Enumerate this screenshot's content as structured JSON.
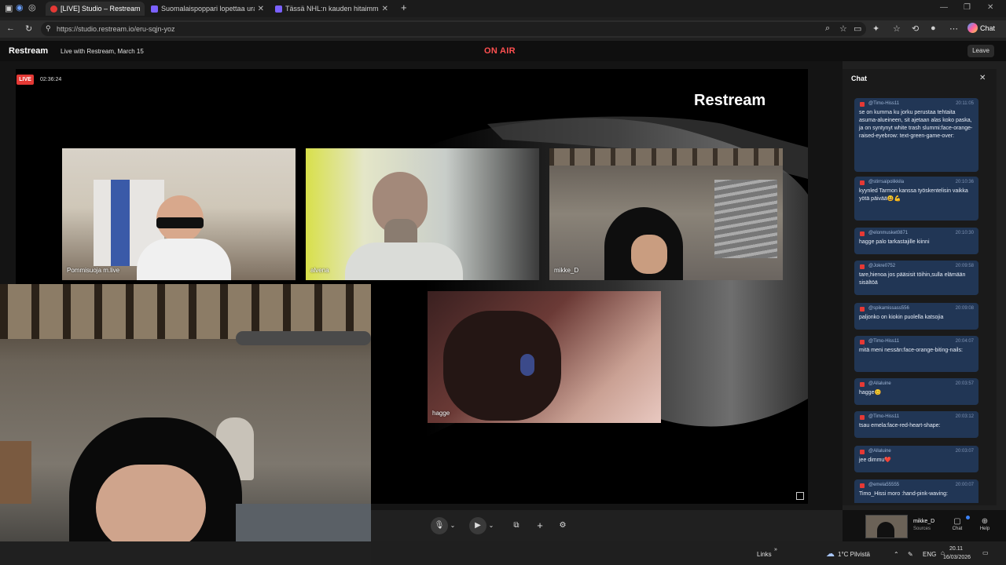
{
  "browser": {
    "tabs": [
      {
        "title": "[LIVE] Studio – Restream",
        "color": "#e53935",
        "active": true
      },
      {
        "title": "Suomalaispoppari lopettaa uransa",
        "color": "#7b61ff",
        "active": false
      },
      {
        "title": "Tässä NHL:n kauden hitaimmat pe",
        "color": "#7b61ff",
        "active": false
      }
    ],
    "new_tab": "+",
    "url": "https://studio.restream.io/eru-sqjn-yoz",
    "chat_button": "Chat"
  },
  "app": {
    "brand": "Restream",
    "stream_title": "Live with Restream, March 15",
    "on_air": "ON AIR",
    "leave": "Leave"
  },
  "stage": {
    "live_badge": "LIVE",
    "timer": "02:36:24",
    "logo": "Restream",
    "participants": [
      "Pommisuoja m.live",
      "alvena",
      "mikke_D",
      "hagge"
    ]
  },
  "chat": {
    "title": "Chat",
    "messages": [
      {
        "user": "@Timo-Hiss11",
        "time": "20:11:05",
        "text": "se on kumma ku jorku perustaa tehtaita asuma-alueineen, sit ajetaan alas koko paska, ja on syntynyt white trash slummi:face-orange-raised-eyebrow: text-green-game-over:"
      },
      {
        "user": "@stirrsaipolikkila",
        "time": "20:10:36",
        "text": "kyynled Tarmon kanssa työskentelisin vaikka yötä päivää😃💪"
      },
      {
        "user": "@elonmusket0871",
        "time": "20:10:30",
        "text": "hagge palo tarkastajille kiinni"
      },
      {
        "user": "@Jokre0752",
        "time": "20:09:58",
        "text": "tare,hienoa jos pääsisit töihin,sulla elämään sisältöä"
      },
      {
        "user": "@spikamissass556",
        "time": "20:09:08",
        "text": "paljonko on kiokin puolella katsojia"
      },
      {
        "user": "@Timo-Hiss11",
        "time": "20:04:07",
        "text": "mitä meni nessän:face-orange-biting-nails:"
      },
      {
        "user": "@Allaluine",
        "time": "20:03:57",
        "text": "hagge😊"
      },
      {
        "user": "@Timo-Hiss11",
        "time": "20:03:12",
        "text": "tsau emela:face-red-heart-shape:"
      },
      {
        "user": "@Allaluine",
        "time": "20:03:07",
        "text": "jee dimmu❤️"
      },
      {
        "user": "@emela55555",
        "time": "20:00:07",
        "text": "Timo_Hissi moro :hand-pink-waving:"
      }
    ]
  },
  "footer": {
    "source_name": "mikke_D",
    "source_sub": "Sources",
    "chat_btn": "Chat",
    "help_btn": "Help"
  },
  "taskbar": {
    "links": "Links",
    "weather": "1°C  Pilvistä",
    "lang": "ENG",
    "time": "20.11",
    "date": "16/03/2026"
  }
}
